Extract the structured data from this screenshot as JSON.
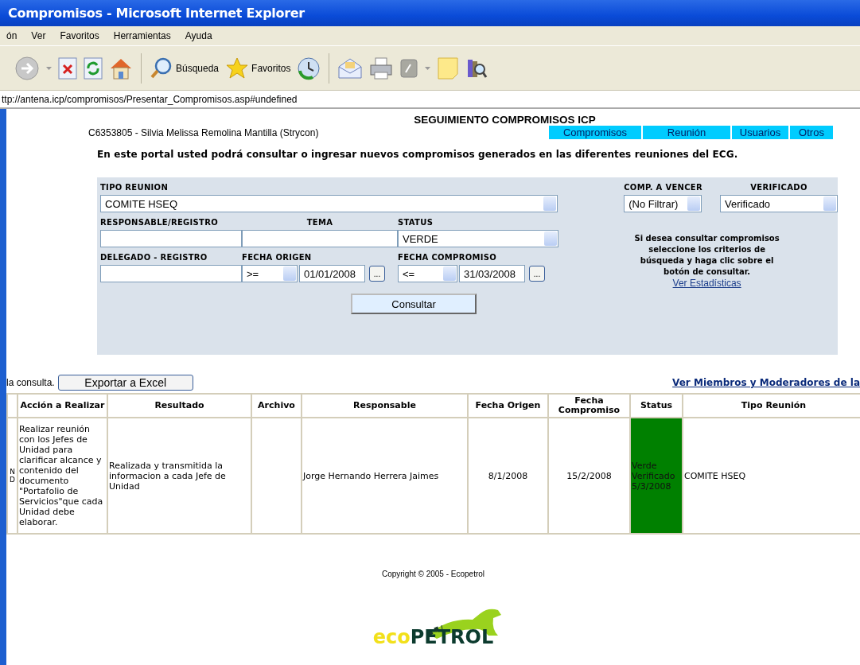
{
  "window": {
    "title": "Compromisos - Microsoft Internet Explorer"
  },
  "menu": [
    "ón",
    "Ver",
    "Favoritos",
    "Herramientas",
    "Ayuda"
  ],
  "toolbar": [
    {
      "kind": "back"
    },
    {
      "kind": "caret"
    },
    {
      "kind": "stop"
    },
    {
      "kind": "refresh"
    },
    {
      "kind": "home"
    },
    {
      "kind": "sep"
    },
    {
      "kind": "search",
      "label": "Búsqueda"
    },
    {
      "kind": "favorites",
      "label": "Favoritos"
    },
    {
      "kind": "history"
    },
    {
      "kind": "sep"
    },
    {
      "kind": "mail"
    },
    {
      "kind": "print"
    },
    {
      "kind": "edit"
    },
    {
      "kind": "caret"
    },
    {
      "kind": "note"
    },
    {
      "kind": "research"
    }
  ],
  "address": "ttp://antena.icp/compromisos/Presentar_Compromisos.asp#undefined",
  "page": {
    "heading": "SEGUIMIENTO COMPROMISOS ICP",
    "user": "C6353805 - Silvia Melissa Remolina Mantilla (Strycon)",
    "nav": [
      "Compromisos",
      "Reunión",
      "Usuarios",
      "Otros"
    ],
    "intro": "En este portal usted podrá consultar o ingresar nuevos compromisos generados en las diferentes reuniones del ECG."
  },
  "form": {
    "tipo_reunion": {
      "label": "TIPO REUNION",
      "value": "COMITE HSEQ"
    },
    "comp_a_vencer": {
      "label": "COMP. A VENCER",
      "value": "(No Filtrar)"
    },
    "verificado": {
      "label": "VERIFICADO",
      "value": "Verificado"
    },
    "responsable": {
      "label": "RESPONSABLE/REGISTRO"
    },
    "tema": {
      "label": "TEMA"
    },
    "status": {
      "label": "STATUS",
      "value": "VERDE"
    },
    "delegado": {
      "label": "DELEGADO - REGISTRO"
    },
    "fecha_origen": {
      "label": "FECHA ORIGEN",
      "operator": ">=",
      "value": "01/01/2008",
      "button": "..."
    },
    "fecha_compromiso": {
      "label": "FECHA COMPROMISO",
      "operator": "<=",
      "value": "31/03/2008",
      "button": "..."
    },
    "help": "Si desea consultar compromisos seleccione los criterios de búsqueda y haga clic sobre el botón de consultar.",
    "stats_link": "Ver Estadísticas",
    "submit": "Consultar"
  },
  "results": {
    "note": "la consulta.",
    "export": "Exportar a Excel",
    "members_link": "Ver Miembros y Moderadores de la",
    "columns": [
      "Acción a Realizar",
      "Resultado",
      "Archivo",
      "Responsable",
      "Fecha Origen",
      "Fecha Compromiso",
      "Status",
      "Tipo Reunión"
    ],
    "rows": [
      {
        "column_1": [
          "N",
          "D"
        ],
        "accion": "Realizar reunión con los Jefes de Unidad para clarificar alcance y contenido del documento \"Portafolio de Servicios\"que cada Unidad debe elaborar.",
        "resultado": "Realizada y transmitida la informacion a cada Jefe de Unidad",
        "responsable": "Jorge Hernando Herrera Jaimes",
        "fecha_origen": "8/1/2008",
        "fecha_compromiso": "15/2/2008",
        "status": "Verde Verificado 5/3/2008",
        "color": "#008000",
        "tipo": "COMITE HSEQ"
      }
    ]
  },
  "footer": {
    "copyright": "Copyright © 2005 - Ecopetrol",
    "logo": [
      "eco",
      "PETROL"
    ]
  }
}
